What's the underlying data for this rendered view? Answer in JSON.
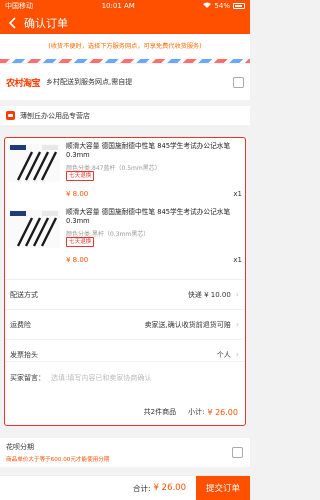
{
  "status_bar": {
    "carrier": "中国移动",
    "time": "10:01 AM",
    "battery": "54%"
  },
  "header": {
    "title": "确认订单"
  },
  "notice": "(收货不便时，选择下方服务网点，可享免费代收货服务)",
  "cuntao": {
    "brand": "农村淘宝",
    "text": "乡村配送到服务网点,需自提"
  },
  "shop": {
    "name": "薄刨丘办公用品专营店"
  },
  "items": [
    {
      "name": "顺滑大容量 德国施耐德中性笔 845学生考试办公记水笔0.3mm",
      "sku": "颜色分类:847蓝杆（0.5mm黑芯）",
      "tag": "七天退换",
      "price": "¥ 8.00",
      "qty": "x1"
    },
    {
      "name": "顺滑大容量 德国施耐德中性笔 845学生考试办公记水笔0.3mm",
      "sku": "颜色分类:黑杆（0.3mm黑芯）",
      "tag": "七天退换",
      "price": "¥ 8.00",
      "qty": "x1"
    }
  ],
  "rows": {
    "delivery": {
      "label": "配送方式",
      "value": "快递 ¥ 10.00"
    },
    "insurance": {
      "label": "运费险",
      "value": "卖家送,确认收货前退货可赔"
    },
    "invoice": {
      "label": "发票抬头",
      "value": "个人"
    }
  },
  "message": {
    "label": "买家留言：",
    "placeholder": "选填:填写内容已和卖家协商确认"
  },
  "summary": {
    "count": "共2件商品",
    "subtotal_label": "小计:",
    "subtotal": "¥ 26.00"
  },
  "installment": {
    "title": "花呗分期",
    "note": "商品单价大于等于600.00元才能使用分期"
  },
  "footer": {
    "total_label": "合计:",
    "total": "¥ 26.00",
    "submit": "提交订单"
  },
  "colors": {
    "accent": "#ff5000",
    "border_red": "#e8352b"
  }
}
